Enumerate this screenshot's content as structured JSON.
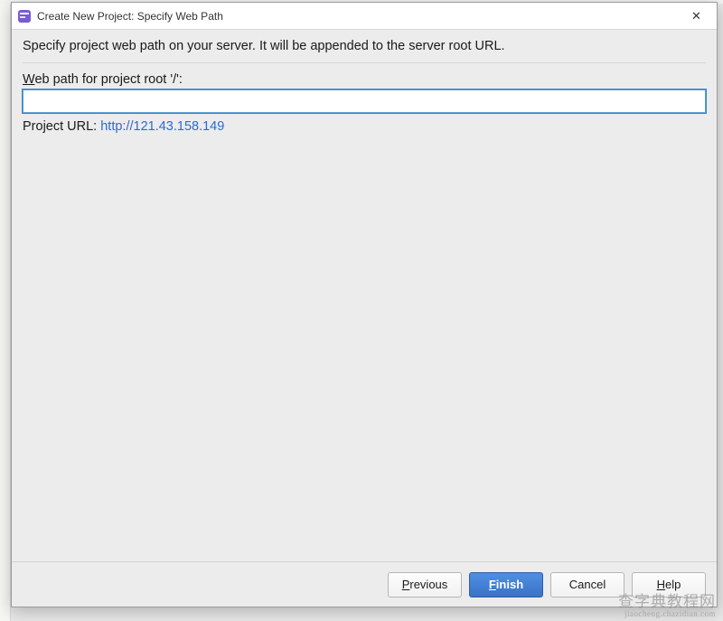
{
  "titlebar": {
    "title": "Create New Project: Specify Web Path",
    "close_symbol": "✕"
  },
  "content": {
    "instruction": "Specify project web path on your server. It will be appended to the server root URL.",
    "field_label_pre": "W",
    "field_label_rest": "eb path for project root '/':",
    "input_value": "",
    "url_label": "Project URL: ",
    "url_value": "http://121.43.158.149"
  },
  "buttons": {
    "previous_u": "P",
    "previous_rest": "revious",
    "finish_u": "F",
    "finish_rest": "inish",
    "cancel": "Cancel",
    "help_u": "H",
    "help_rest": "elp"
  },
  "watermark": {
    "main": "查字典教程网",
    "sub": "jiaocheng.chazidian.com"
  }
}
